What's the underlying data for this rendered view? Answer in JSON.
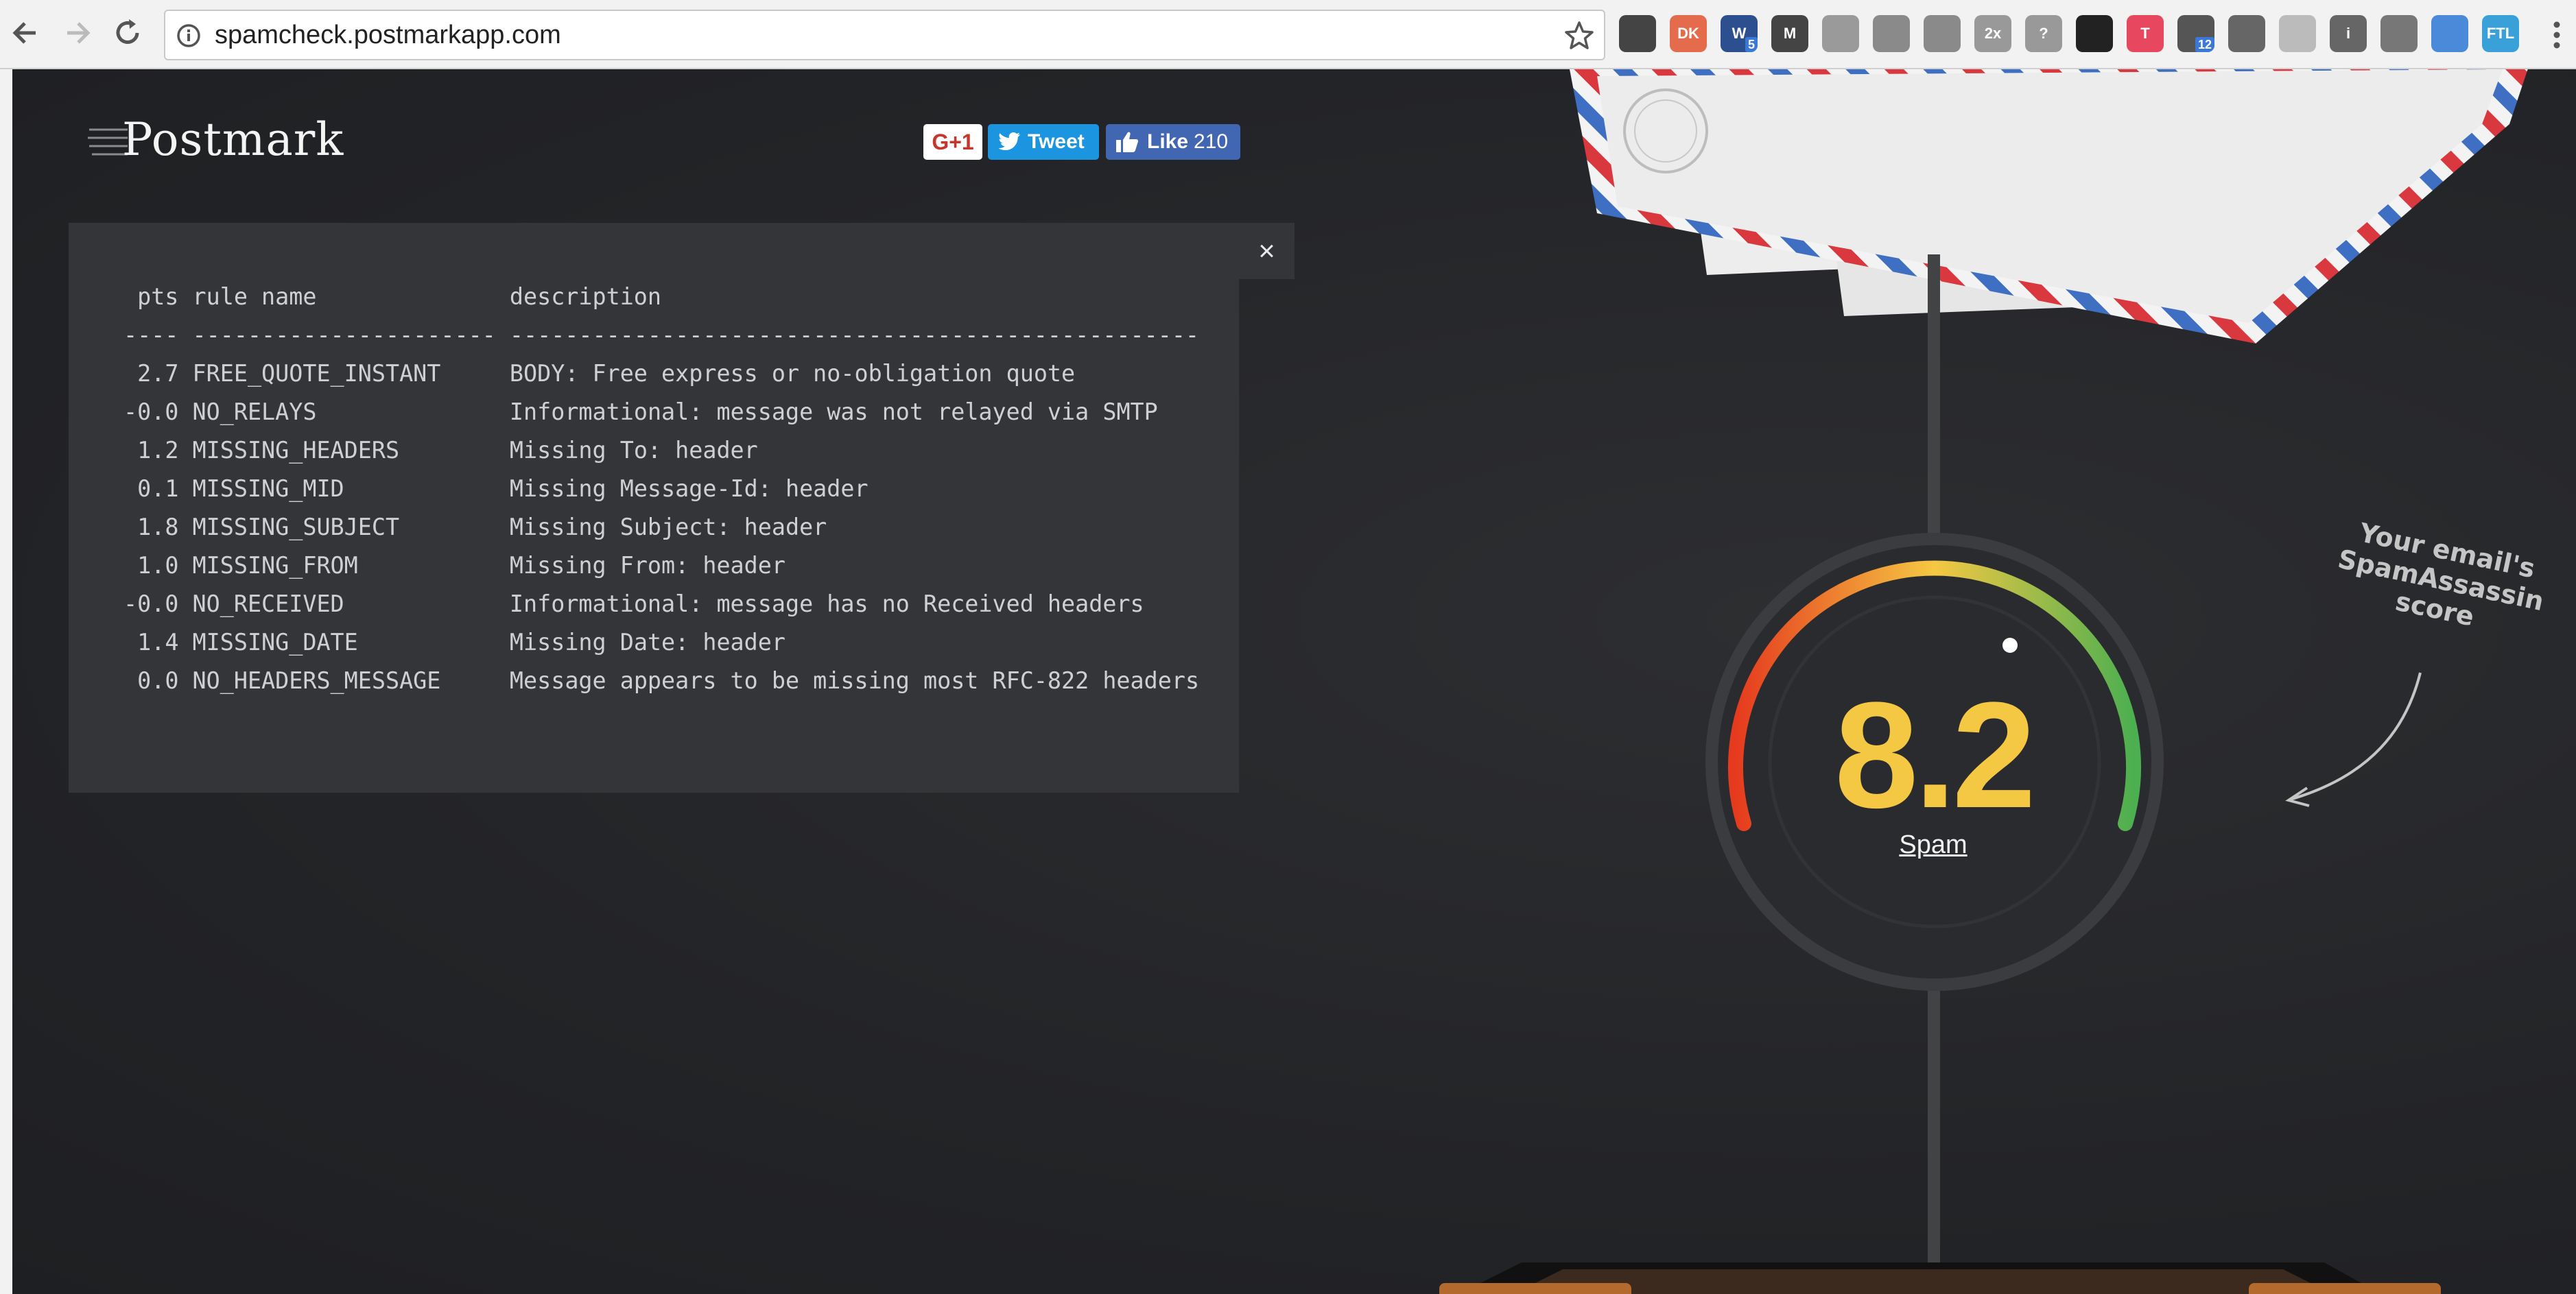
{
  "browser": {
    "url": "spamcheck.postmarkapp.com",
    "extensions": [
      {
        "icon": "pocket-icon",
        "label": "",
        "color": "#444"
      },
      {
        "icon": "dk-icon",
        "label": "DK",
        "color": "#e46b4b"
      },
      {
        "icon": "w-icon",
        "label": "W",
        "color": "#2c4f8f",
        "badge": "5"
      },
      {
        "icon": "m-icon",
        "label": "M",
        "color": "#444"
      },
      {
        "icon": "dropbox-icon",
        "label": "",
        "color": "#9a9a9a"
      },
      {
        "icon": "square-icon",
        "label": "",
        "color": "#8a8a8a"
      },
      {
        "icon": "spy-icon",
        "label": "",
        "color": "#8a8a8a"
      },
      {
        "icon": "2x-icon",
        "label": "2x",
        "color": "#999"
      },
      {
        "icon": "help-box-icon",
        "label": "?",
        "color": "#999"
      },
      {
        "icon": "panda-icon",
        "label": "",
        "color": "#222"
      },
      {
        "icon": "t-icon",
        "label": "T",
        "color": "#e8485f"
      },
      {
        "icon": "chart-icon",
        "label": "",
        "color": "#555",
        "badge": "12"
      },
      {
        "icon": "swoosh-icon",
        "label": "",
        "color": "#666"
      },
      {
        "icon": "leaf-icon",
        "label": "",
        "color": "#bbb"
      },
      {
        "icon": "info-icon",
        "label": "i",
        "color": "#666"
      },
      {
        "icon": "bird-icon",
        "label": "",
        "color": "#777"
      },
      {
        "icon": "tab-icon",
        "label": "",
        "color": "#4a8ad8"
      },
      {
        "icon": "ftl-icon",
        "label": "FTL",
        "color": "#3aa0d8"
      }
    ]
  },
  "header": {
    "logo": "Postmark",
    "gplus_label": "G+1",
    "tweet_label": "Tweet",
    "like_label": "Like",
    "like_count": "210"
  },
  "report": {
    "close_label": "×",
    "header_line": " pts rule name              description",
    "separator_line": "---- ---------------------- --------------------------------------------------",
    "rows": [
      {
        "pts": "2.7",
        "rule": "FREE_QUOTE_INSTANT",
        "description": "BODY: Free express or no-obligation quote"
      },
      {
        "pts": "-0.0",
        "rule": "NO_RELAYS",
        "description": "Informational: message was not relayed via SMTP"
      },
      {
        "pts": "1.2",
        "rule": "MISSING_HEADERS",
        "description": "Missing To: header"
      },
      {
        "pts": "0.1",
        "rule": "MISSING_MID",
        "description": "Missing Message-Id: header"
      },
      {
        "pts": "1.8",
        "rule": "MISSING_SUBJECT",
        "description": "Missing Subject: header"
      },
      {
        "pts": "1.0",
        "rule": "MISSING_FROM",
        "description": "Missing From: header"
      },
      {
        "pts": "-0.0",
        "rule": "NO_RECEIVED",
        "description": "Informational: message has no Received headers"
      },
      {
        "pts": "1.4",
        "rule": "MISSING_DATE",
        "description": "Missing Date: header"
      },
      {
        "pts": "0.0",
        "rule": "NO_HEADERS_MESSAGE",
        "description": "Message appears to be missing most RFC-822 headers"
      }
    ]
  },
  "gauge": {
    "score": "8.2",
    "verdict": "Spam",
    "annotation_line1": "Your email's",
    "annotation_line2": "SpamAssassin score",
    "colors": {
      "low": "#4caf50",
      "mid": "#f5c843",
      "high": "#e53a1e"
    }
  }
}
